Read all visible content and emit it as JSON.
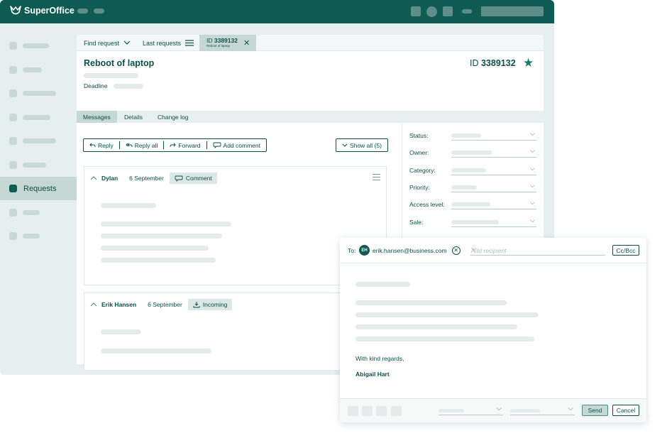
{
  "app": {
    "name": "SuperOffice"
  },
  "sidebar": {
    "active_label": "Requests"
  },
  "tabbar": {
    "find_request": "Find request",
    "last_requests": "Last requests",
    "active_tab_prefix": "ID",
    "active_tab_id": "3389132",
    "active_tab_sub": "Reboot of laptop"
  },
  "request": {
    "title": "Reboot of laptop",
    "id_prefix": "ID",
    "id": "3389132",
    "deadline_label": "Deadline"
  },
  "subtabs": {
    "messages": "Messages",
    "details": "Details",
    "change_log": "Change log"
  },
  "actions": {
    "reply": "Reply",
    "reply_all": "Reply all",
    "forward": "Forward",
    "add_comment": "Add comment",
    "show_all": "Show all (5)"
  },
  "messages": [
    {
      "author": "Dylan",
      "date": "6 September",
      "badge": "Comment"
    },
    {
      "author": "Erik Hansen",
      "date": "6 September",
      "badge": "Incoming"
    }
  ],
  "properties": {
    "status": "Status:",
    "owner": "Owner:",
    "category": "Category:",
    "priority": "Priority:",
    "access_level": "Access level:",
    "sale": "Sale:"
  },
  "composer": {
    "to_label": "To:",
    "recipient_initials": "EH",
    "recipient_email": "erik.hansen@business.com",
    "add_recipient_placeholder": "Add recipient",
    "ccbcc": "Cc/Bcc",
    "regards": "With kind regards,",
    "signature": "Abigail Hart",
    "send": "Send",
    "cancel": "Cancel"
  },
  "colors": {
    "brand": "#0d5b52",
    "accent_light": "#c5d8d5",
    "background": "#e6efee"
  }
}
